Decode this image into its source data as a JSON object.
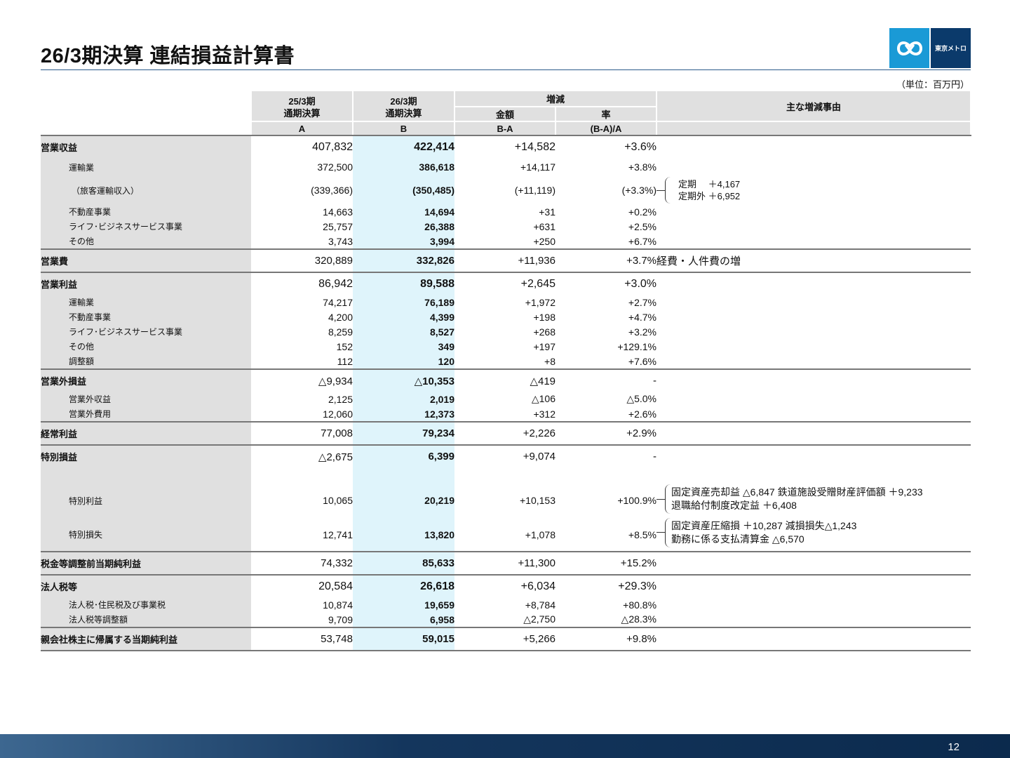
{
  "title": "26/3期決算 連結損益計算書",
  "logo": {
    "text": "東京メトロ",
    "colors": {
      "mark": "#1a9ad6",
      "text_bg": "#0b3a6b"
    }
  },
  "unit": "（単位：百万円）",
  "header": {
    "col_a_line1": "25/3期",
    "col_a_line2": "通期決算",
    "col_a_code": "A",
    "col_b_line1": "26/3期",
    "col_b_line2": "通期決算",
    "col_b_code": "B",
    "change": "増減",
    "amount": "金額",
    "amount_code": "B-A",
    "rate": "率",
    "rate_code": "(B-A)/A",
    "reason": "主な増減事由"
  },
  "rows": [
    {
      "label": "営業収益",
      "a": "407,832",
      "b": "422,414",
      "diff": "+14,582",
      "rate": "+3.6%"
    },
    {
      "label": "運輸業",
      "a": "372,500",
      "b": "386,618",
      "diff": "+14,117",
      "rate": "+3.8%"
    },
    {
      "label": "（旅客運輸収入）",
      "a": "(339,366)",
      "b": "(350,485)",
      "diff": "(+11,119)",
      "rate": "(+3.3%)",
      "note_lines": [
        "定期　 ＋4,167",
        "定期外 ＋6,952"
      ]
    },
    {
      "label": "不動産事業",
      "a": "14,663",
      "b": "14,694",
      "diff": "+31",
      "rate": "+0.2%"
    },
    {
      "label": "ライフ･ビジネスサービス事業",
      "a": "25,757",
      "b": "26,388",
      "diff": "+631",
      "rate": "+2.5%"
    },
    {
      "label": "その他",
      "a": "3,743",
      "b": "3,994",
      "diff": "+250",
      "rate": "+6.7%"
    },
    {
      "label": "営業費",
      "a": "320,889",
      "b": "332,826",
      "diff": "+11,936",
      "rate": "+3.7%",
      "note": "経費・人件費の増"
    },
    {
      "label": "営業利益",
      "a": "86,942",
      "b": "89,588",
      "diff": "+2,645",
      "rate": "+3.0%"
    },
    {
      "label": "運輸業",
      "a": "74,217",
      "b": "76,189",
      "diff": "+1,972",
      "rate": "+2.7%"
    },
    {
      "label": "不動産事業",
      "a": "4,200",
      "b": "4,399",
      "diff": "+198",
      "rate": "+4.7%"
    },
    {
      "label": "ライフ･ビジネスサービス事業",
      "a": "8,259",
      "b": "8,527",
      "diff": "+268",
      "rate": "+3.2%"
    },
    {
      "label": "その他",
      "a": "152",
      "b": "349",
      "diff": "+197",
      "rate": "+129.1%"
    },
    {
      "label": "調整額",
      "a": "112",
      "b": "120",
      "diff": "+8",
      "rate": "+7.6%"
    },
    {
      "label": "営業外損益",
      "a": "△9,934",
      "b": "△10,353",
      "diff": "△419",
      "rate": "-"
    },
    {
      "label": "営業外収益",
      "a": "2,125",
      "b": "2,019",
      "diff": "△106",
      "rate": "△5.0%"
    },
    {
      "label": "営業外費用",
      "a": "12,060",
      "b": "12,373",
      "diff": "+312",
      "rate": "+2.6%"
    },
    {
      "label": "経常利益",
      "a": "77,008",
      "b": "79,234",
      "diff": "+2,226",
      "rate": "+2.9%"
    },
    {
      "label": "特別損益",
      "a": "△2,675",
      "b": "6,399",
      "diff": "+9,074",
      "rate": "-"
    },
    {
      "label": "特別利益",
      "a": "10,065",
      "b": "20,219",
      "diff": "+10,153",
      "rate": "+100.9%",
      "note_lines": [
        "固定資産売却益 △6,847 鉄道施設受贈財産評価額 ＋9,233",
        "退職給付制度改定益 ＋6,408"
      ]
    },
    {
      "label": "特別損失",
      "a": "12,741",
      "b": "13,820",
      "diff": "+1,078",
      "rate": "+8.5%",
      "note_lines": [
        "固定資産圧縮損 ＋10,287 減損損失△1,243",
        "勤務に係る支払清算金 △6,570"
      ]
    },
    {
      "label": "税金等調整前当期純利益",
      "a": "74,332",
      "b": "85,633",
      "diff": "+11,300",
      "rate": "+15.2%"
    },
    {
      "label": "法人税等",
      "a": "20,584",
      "b": "26,618",
      "diff": "+6,034",
      "rate": "+29.3%"
    },
    {
      "label": "法人税･住民税及び事業税",
      "a": "10,874",
      "b": "19,659",
      "diff": "+8,784",
      "rate": "+80.8%"
    },
    {
      "label": "法人税等調整額",
      "a": "9,709",
      "b": "6,958",
      "diff": "△2,750",
      "rate": "△28.3%"
    },
    {
      "label": "親会社株主に帰属する当期純利益",
      "a": "53,748",
      "b": "59,015",
      "diff": "+5,266",
      "rate": "+9.8%"
    }
  ],
  "page_number": "12"
}
